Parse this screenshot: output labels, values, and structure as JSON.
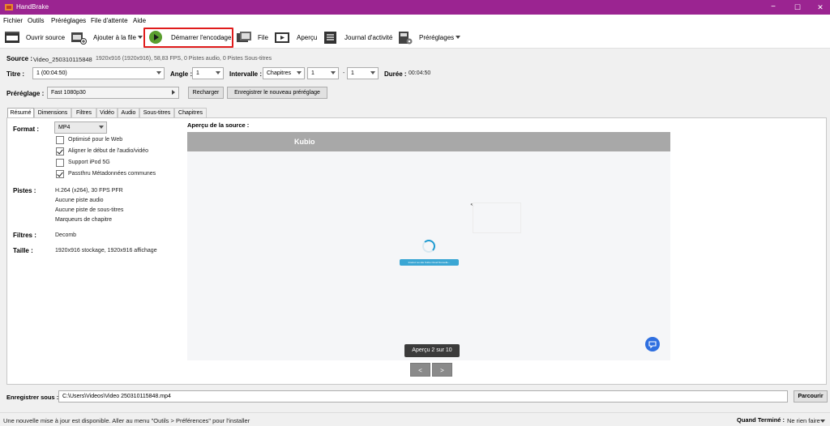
{
  "window": {
    "title": "HandBrake",
    "controls": {
      "minimize": "−",
      "maximize": "☐",
      "close": "✕"
    }
  },
  "menu": [
    "Fichier",
    "Outils",
    "Préréglages",
    "File d'attente",
    "Aide"
  ],
  "toolbar": {
    "open_source": "Ouvrir source",
    "add_to_queue": "Ajouter à la file",
    "start_encode": "Démarrer l'encodage",
    "queue": "File",
    "preview": "Aperçu",
    "activity_log": "Journal d'activité",
    "presets": "Préréglages"
  },
  "source": {
    "label": "Source :",
    "name": "Video_250310115848",
    "info": "1920x916 (1920x916), 58,83 FPS, 0 Pistes audio, 0 Pistes Sous-titres"
  },
  "title_row": {
    "title_label": "Titre :",
    "title_value": "1 (00:04:50)",
    "angle_label": "Angle :",
    "angle_value": "1",
    "range_label": "Intervalle :",
    "range_type": "Chapitres",
    "range_start": "1",
    "range_dash": "-",
    "range_end": "1",
    "duration_label": "Durée :",
    "duration_value": "00:04:50"
  },
  "preset_row": {
    "label": "Préréglage :",
    "value": "Fast 1080p30",
    "reload": "Recharger",
    "save_new": "Enregistrer le nouveau préréglage"
  },
  "tabs": [
    "Résumé",
    "Dimensions",
    "Filtres",
    "Vidéo",
    "Audio",
    "Sous-titres",
    "Chapitres"
  ],
  "summary": {
    "format_label": "Format :",
    "format_value": "MP4",
    "options": [
      {
        "label": "Optimisé pour le Web",
        "checked": false
      },
      {
        "label": "Aligner le début de l'audio/vidéo",
        "checked": true
      },
      {
        "label": "Support iPod 5G",
        "checked": false
      },
      {
        "label": "Passthru Métadonnées communes",
        "checked": true
      }
    ],
    "tracks_label": "Pistes :",
    "tracks": [
      "H.264 (x264), 30 FPS PFR",
      "Aucune piste audio",
      "Aucune piste de sous-titres",
      "Marqueurs de chapitre"
    ],
    "filters_label": "Filtres :",
    "filters_value": "Decomb",
    "size_label": "Taille :",
    "size_value": "1920x916 stockage, 1920x916 affichage"
  },
  "preview": {
    "label": "Aperçu de la source :",
    "logo_text": "Kubio",
    "button_text": "Insérez au site Kubio Cloud Nouvelle...",
    "badge": "Aperçu 2 sur 10",
    "prev": "<",
    "next": ">"
  },
  "save": {
    "label": "Enregistrer sous :",
    "path": "C:\\Users\\Videos\\Video 250310115848.mp4",
    "browse": "Parcourir"
  },
  "status": {
    "message": "Une nouvelle mise à jour est disponible. Aller au menu \"Outils > Préférences\" pour l'installer",
    "when_done_label": "Quand Terminé :",
    "when_done_value": "Ne rien faire"
  },
  "colors": {
    "titlebar": "#9b2491",
    "highlight": "#e01c1c",
    "accent": "#3aa6d4"
  }
}
